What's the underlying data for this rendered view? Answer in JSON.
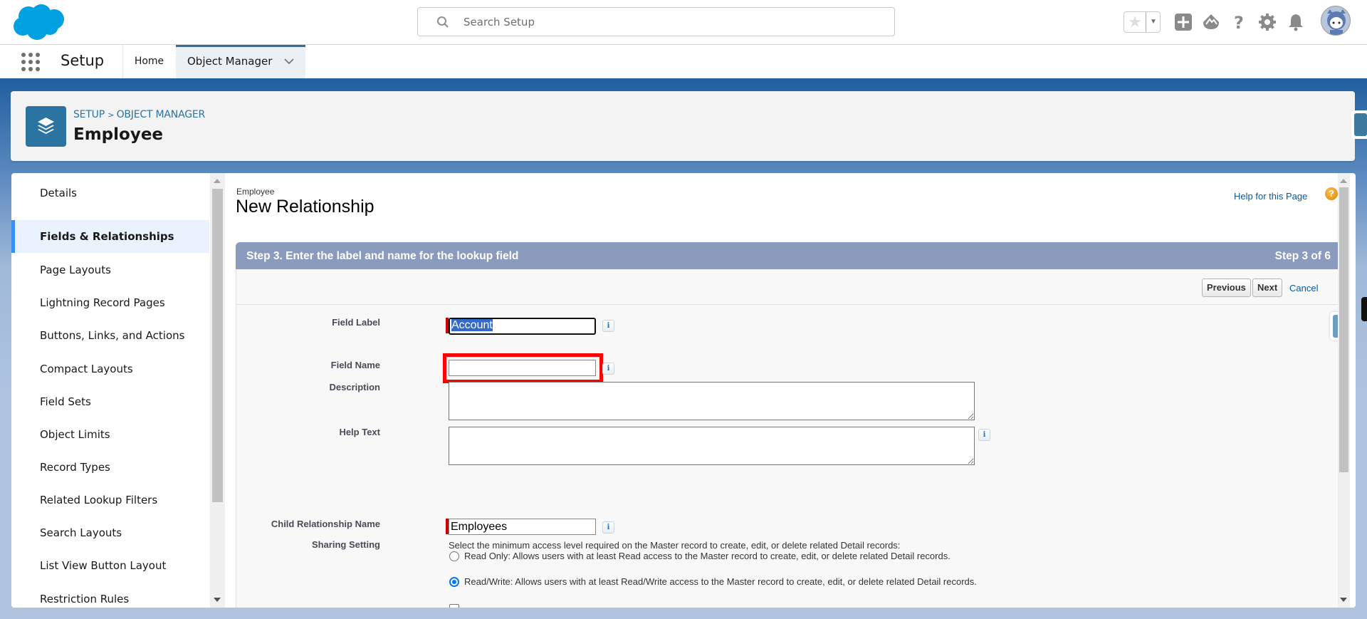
{
  "topbar": {
    "search_placeholder": "Search Setup",
    "icons": [
      "salesforce-cloud-logo",
      "search-icon",
      "favorites-star-icon",
      "favorites-dropdown-icon",
      "global-actions-plus-icon",
      "trailhead-icon",
      "help-question-icon",
      "setup-gear-icon",
      "notifications-bell-icon",
      "user-avatar"
    ]
  },
  "nav": {
    "app_name": "Setup",
    "tabs": [
      {
        "label": "Home",
        "active": false
      },
      {
        "label": "Object Manager",
        "active": true
      }
    ]
  },
  "header": {
    "breadcrumb": "SETUP > OBJECT MANAGER",
    "breadcrumb_parts": [
      "SETUP",
      "OBJECT MANAGER"
    ],
    "object_name": "Employee"
  },
  "sidebar": {
    "items": [
      {
        "label": "Details",
        "active": false
      },
      {
        "label": "Fields & Relationships",
        "active": true
      },
      {
        "label": "Page Layouts",
        "active": false
      },
      {
        "label": "Lightning Record Pages",
        "active": false
      },
      {
        "label": "Buttons, Links, and Actions",
        "active": false
      },
      {
        "label": "Compact Layouts",
        "active": false
      },
      {
        "label": "Field Sets",
        "active": false
      },
      {
        "label": "Object Limits",
        "active": false
      },
      {
        "label": "Record Types",
        "active": false
      },
      {
        "label": "Related Lookup Filters",
        "active": false
      },
      {
        "label": "Search Layouts",
        "active": false
      },
      {
        "label": "List View Button Layout",
        "active": false
      },
      {
        "label": "Restriction Rules",
        "active": false
      }
    ]
  },
  "main": {
    "object_label": "Employee",
    "page_title": "New Relationship",
    "help_link": "Help for this Page",
    "step": {
      "title": "Step 3. Enter the label and name for the lookup field",
      "count": "Step 3 of 6"
    },
    "buttons": {
      "previous": "Previous",
      "next": "Next",
      "cancel": "Cancel"
    },
    "fields": {
      "field_label": {
        "label": "Field Label",
        "value": "Account",
        "required": true
      },
      "field_name": {
        "label": "Field Name",
        "value": "",
        "required": true
      },
      "description": {
        "label": "Description",
        "value": ""
      },
      "help_text": {
        "label": "Help Text",
        "value": ""
      },
      "child_relationship_name": {
        "label": "Child Relationship Name",
        "value": "Employees",
        "required": true
      },
      "sharing_setting": {
        "label": "Sharing Setting",
        "intro": "Select the minimum access level required on the Master record to create, edit, or delete related Detail records:",
        "options": [
          {
            "label": "Read Only: Allows users with at least Read access to the Master record to create, edit, or delete related Detail records.",
            "selected": false
          },
          {
            "label": "Read/Write: Allows users with at least Read/Write access to the Master record to create, edit, or delete related Detail records.",
            "selected": true
          }
        ]
      }
    }
  },
  "colors": {
    "brand_blue": "#00a1e0",
    "object_icon": "#2b73a1",
    "active_tab_border": "#2e6f9e",
    "step_bar": "#8a9bbd",
    "required_marker": "#cc0000",
    "highlight_box": "#ff0000",
    "link": "#015ba7",
    "selection": "#3469c8"
  }
}
